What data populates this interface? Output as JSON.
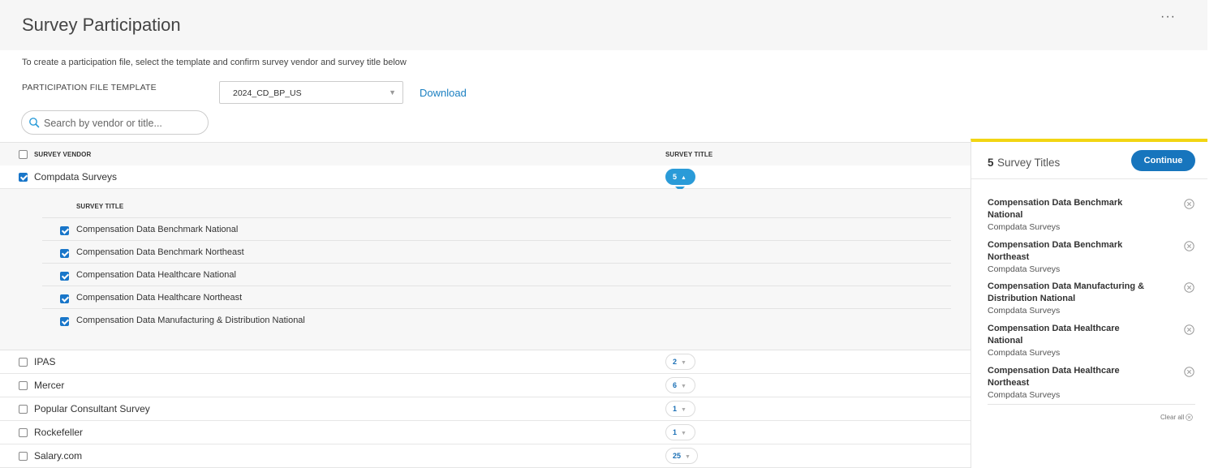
{
  "header": {
    "title": "Survey Participation",
    "more_label": "···"
  },
  "intro": "To create a participation file, select the template and confirm survey vendor and survey title below",
  "template": {
    "label": "PARTICIPATION FILE TEMPLATE",
    "value": "2024_CD_BP_US",
    "download_label": "Download"
  },
  "search": {
    "placeholder": "Search by vendor or title..."
  },
  "table": {
    "col_vendor": "SURVEY VENDOR",
    "col_title": "SURVEY TITLE",
    "sub_col_title": "SURVEY TITLE"
  },
  "vendors": [
    {
      "name": "Compdata Surveys",
      "count": "5",
      "checked": true,
      "expanded": true
    },
    {
      "name": "IPAS",
      "count": "2",
      "checked": false
    },
    {
      "name": "Mercer",
      "count": "6",
      "checked": false
    },
    {
      "name": "Popular Consultant Survey",
      "count": "1",
      "checked": false
    },
    {
      "name": "Rockefeller",
      "count": "1",
      "checked": false
    },
    {
      "name": "Salary.com",
      "count": "25",
      "checked": false
    }
  ],
  "compdata_titles": [
    "Compensation Data Benchmark National",
    "Compensation Data Benchmark Northeast",
    "Compensation Data Healthcare National",
    "Compensation Data Healthcare Northeast",
    "Compensation Data Manufacturing & Distribution National"
  ],
  "panel": {
    "count": "5",
    "title": "Survey Titles",
    "continue_label": "Continue",
    "clear_label": "Clear all",
    "items": [
      {
        "title": "Compensation Data Benchmark National",
        "vendor": "Compdata Surveys"
      },
      {
        "title": "Compensation Data Benchmark Northeast",
        "vendor": "Compdata Surveys"
      },
      {
        "title": "Compensation Data Manufacturing & Distribution National",
        "vendor": "Compdata Surveys"
      },
      {
        "title": "Compensation Data Healthcare National",
        "vendor": "Compdata Surveys"
      },
      {
        "title": "Compensation Data Healthcare Northeast",
        "vendor": "Compdata Surveys"
      }
    ]
  },
  "colors": {
    "accent": "#1775bd",
    "pill_open": "#2a9bd8",
    "panel_top": "#f2d513"
  }
}
